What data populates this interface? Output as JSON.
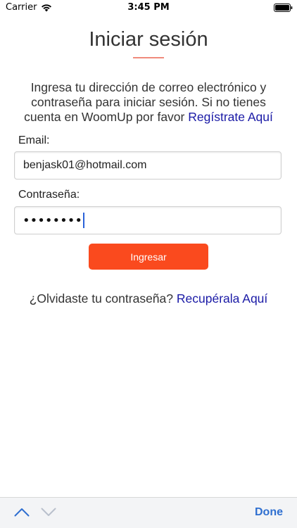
{
  "status_bar": {
    "carrier": "Carrier",
    "time": "3:45 PM",
    "wifi_icon": "wifi-icon",
    "battery_icon": "battery-icon"
  },
  "title": "Iniciar sesión",
  "intro": {
    "text": "Ingresa tu dirección de correo electrónico y contraseña para iniciar sesión. Si no tienes cuenta en WoomUp por favor",
    "register_link": "Regístrate Aquí"
  },
  "form": {
    "email_label": "Email:",
    "email_value": "benjask01@hotmail.com",
    "password_label": "Contraseña:",
    "password_masked": "••••••••",
    "submit_label": "Ingresar"
  },
  "forgot": {
    "text": "¿Olvidaste tu contraseña?",
    "recover_link": "Recupérala Aquí"
  },
  "accessory_bar": {
    "prev_icon": "chevron-up-icon",
    "next_icon": "chevron-down-icon",
    "done_label": "Done"
  },
  "colors": {
    "accent_button": "#fa4a1e",
    "link": "#1a1aa6",
    "title_underline": "#f08a7c",
    "done": "#2f6fd0"
  }
}
